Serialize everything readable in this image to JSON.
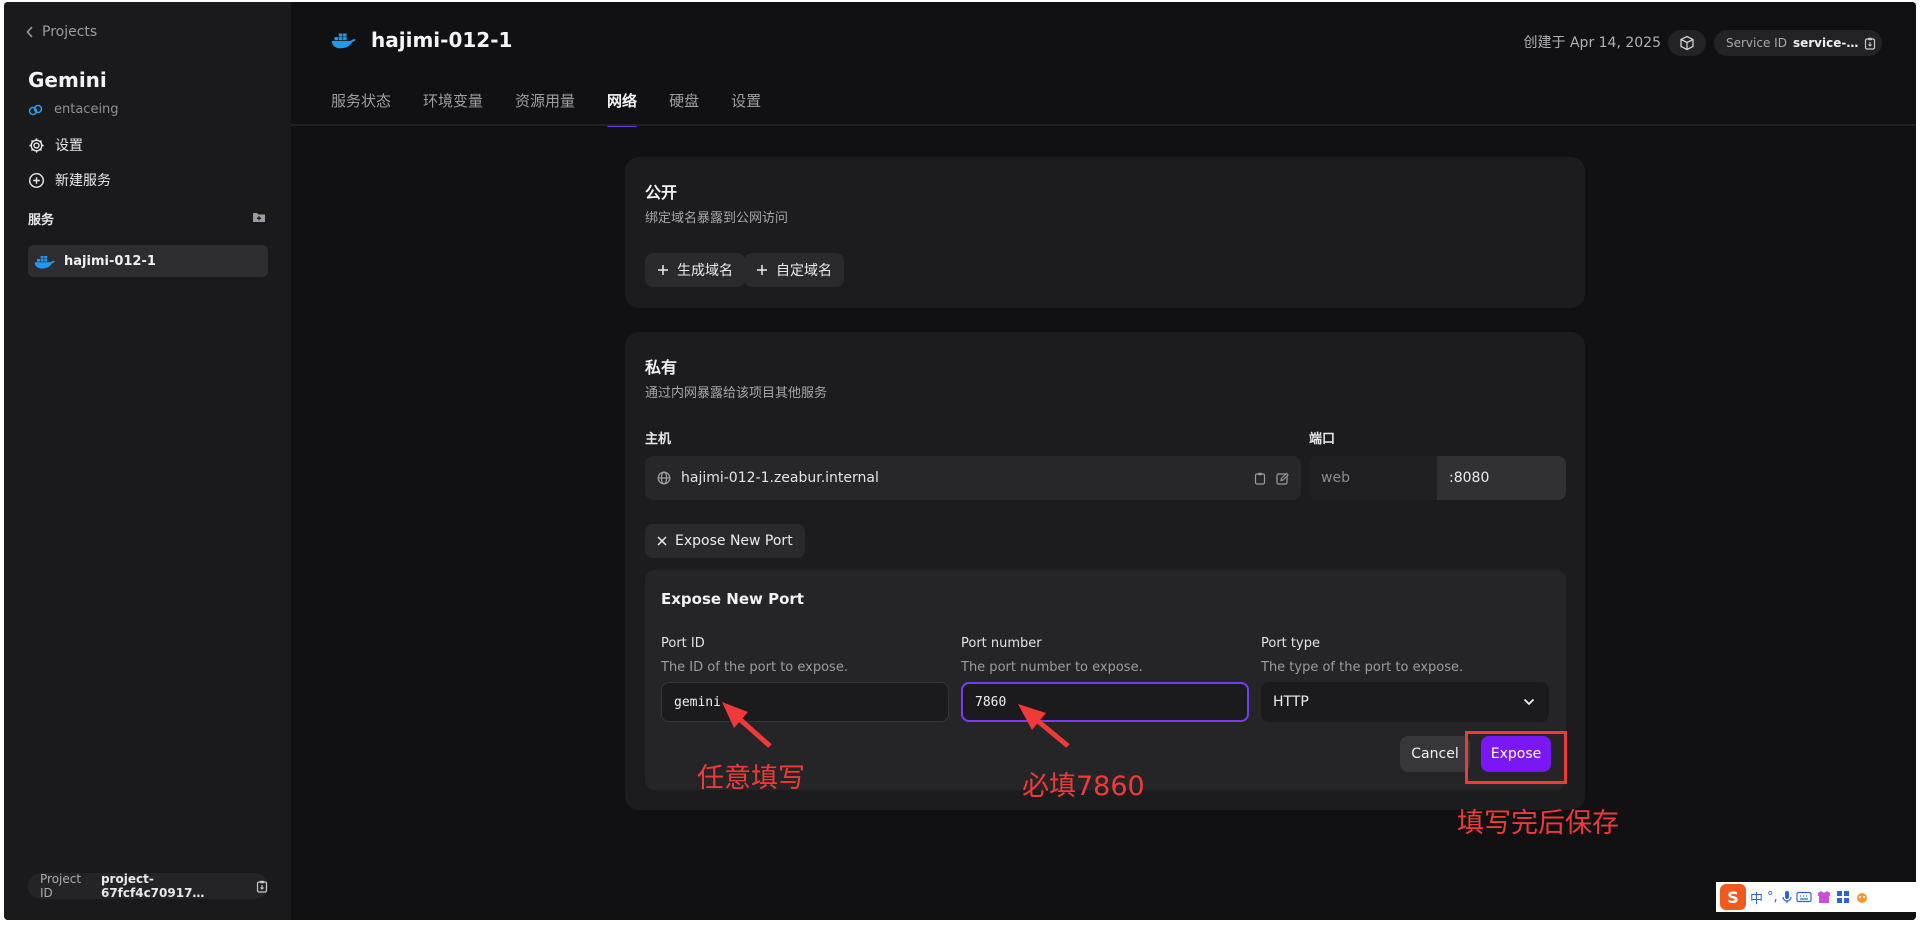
{
  "sidebar": {
    "back_label": "Projects",
    "project_name": "Gemini",
    "workspace": "entaceing",
    "settings_label": "设置",
    "new_service_label": "新建服务",
    "services_header": "服务",
    "services": [
      {
        "label": "hajimi-012-1"
      }
    ],
    "project_id_label": "Project ID",
    "project_id_value": "project-67fcf4c70917…"
  },
  "header": {
    "service_name": "hajimi-012-1",
    "created": "创建于 Apr 14, 2025",
    "service_id_label": "Service ID",
    "service_id_value": "service-…"
  },
  "tabs": [
    {
      "label": "服务状态",
      "active": false
    },
    {
      "label": "环境变量",
      "active": false
    },
    {
      "label": "资源用量",
      "active": false
    },
    {
      "label": "网络",
      "active": true
    },
    {
      "label": "硬盘",
      "active": false
    },
    {
      "label": "设置",
      "active": false
    }
  ],
  "public": {
    "title": "公开",
    "subtitle": "绑定域名暴露到公网访问",
    "generate_domain": "生成域名",
    "custom_domain": "自定域名"
  },
  "private": {
    "title": "私有",
    "subtitle": "通过内网暴露给该项目其他服务",
    "host_label": "主机",
    "host_value": "hajimi-012-1.zeabur.internal",
    "port_label": "端口",
    "port_name": "web",
    "port_value": ":8080",
    "toggle_expose": "Expose New Port"
  },
  "expose_form": {
    "title": "Expose New Port",
    "port_id_label": "Port ID",
    "port_id_desc": "The ID of the port to expose.",
    "port_id_value": "gemini",
    "port_number_label": "Port number",
    "port_number_desc": "The port number to expose.",
    "port_number_value": "7860",
    "port_type_label": "Port type",
    "port_type_desc": "The type of the port to expose.",
    "port_type_value": "HTTP",
    "cancel": "Cancel",
    "expose": "Expose"
  },
  "annotations": {
    "port_id_note": "任意填写",
    "port_number_note": "必填7860",
    "save_note": "填写完后保存"
  },
  "tray": {
    "ime_mode": "中",
    "punct": "°,"
  },
  "colors": {
    "accent": "#7a18f5",
    "annotation": "#f03a3a",
    "docker_blue": "#2496ed"
  }
}
